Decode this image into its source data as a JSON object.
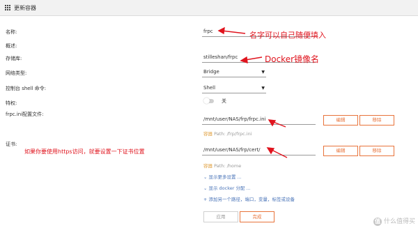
{
  "window": {
    "title": "更新容器"
  },
  "form": {
    "name_label": "名称:",
    "name_value": "frpc",
    "overview_label": "概述:",
    "repo_label": "存储库:",
    "repo_value": "stilleshan/frpc",
    "network_label": "网络类型:",
    "network_value": "Bridge",
    "shell_label": "控制台 shell 命令:",
    "shell_value": "Shell",
    "privileged_label": "特权:",
    "privileged_state": "关",
    "config_label": "frpc.ini配置文件:",
    "config_value": "/mnt/user/NAS/frp/frpc.ini",
    "config_edit": "编辑",
    "config_remove": "移除",
    "config_hint_label": "容器",
    "config_hint_path": "Path: /frp/frpc.ini",
    "cert_label": "证书:",
    "cert_value": "/mnt/user/NAS/frp/cert/",
    "cert_edit": "编辑",
    "cert_remove": "移除",
    "cert_hint_label": "容器",
    "cert_hint_path": "Path: /home",
    "more_settings": "显示更多设置 ...",
    "docker_alloc": "显示 docker 分配 ...",
    "add_item": "添加另一个路径，端口，变量，标签或设备",
    "apply": "应用",
    "done": "完成"
  },
  "annotations": {
    "name_note": "名字可以自己随便填入",
    "repo_note": "Docker镜像名",
    "cert_note": "如果你要使用https访问，就要设置一下证书位置"
  },
  "watermark": {
    "badge": "值",
    "text": "什么值得买"
  },
  "colors": {
    "accent": "#e8733a",
    "annotation": "#e0141e",
    "link": "#4a74b8",
    "hint": "#e0a040"
  },
  "icons": [
    "grid-icon",
    "chevron-down-icon",
    "plus-icon",
    "arrow-icon"
  ]
}
